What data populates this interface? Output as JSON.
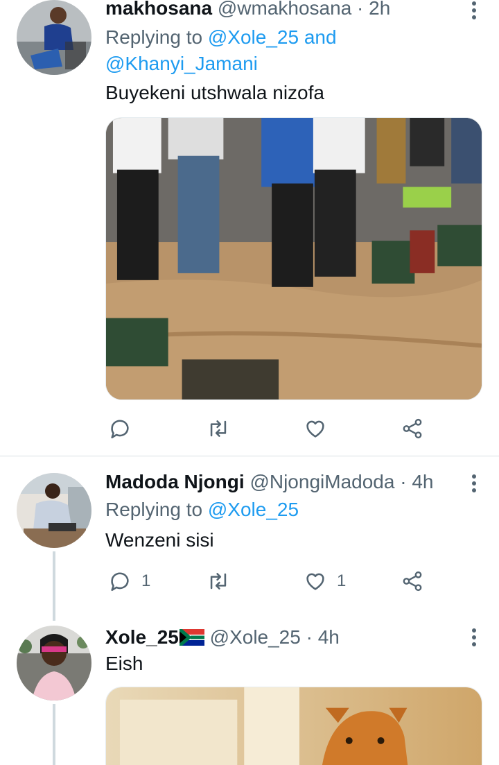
{
  "tweets": [
    {
      "name": "makhosana",
      "handle": "@wmakhosana",
      "separator": "·",
      "time": "2h",
      "replying_prefix": "Replying to",
      "replying_mentions": [
        "@Xole_25",
        "@Khanyi_Jamani"
      ],
      "replying_joiner": "and",
      "text": "Buyekeni utshwala nizofa",
      "actions": {
        "reply_count": "",
        "retweet_count": "",
        "like_count": ""
      }
    },
    {
      "name": "Madoda Njongi",
      "handle": "@NjongiMadoda",
      "separator": "·",
      "time": "4h",
      "replying_prefix": "Replying to",
      "replying_mentions": [
        "@Xole_25"
      ],
      "text": "Wenzeni sisi",
      "actions": {
        "reply_count": "1",
        "retweet_count": "",
        "like_count": "1"
      }
    },
    {
      "name": "Xole_25",
      "flag_emoji": "🇿🇦",
      "handle": "@Xole_25",
      "separator": "·",
      "time": "4h",
      "text": "Eish"
    }
  ],
  "icons": [
    "more-vertical-icon",
    "reply-icon",
    "retweet-icon",
    "like-icon",
    "share-icon"
  ],
  "colors": {
    "mention": "#1d9bf0",
    "secondary_text": "#536471",
    "thread_line": "#cfd9de"
  }
}
